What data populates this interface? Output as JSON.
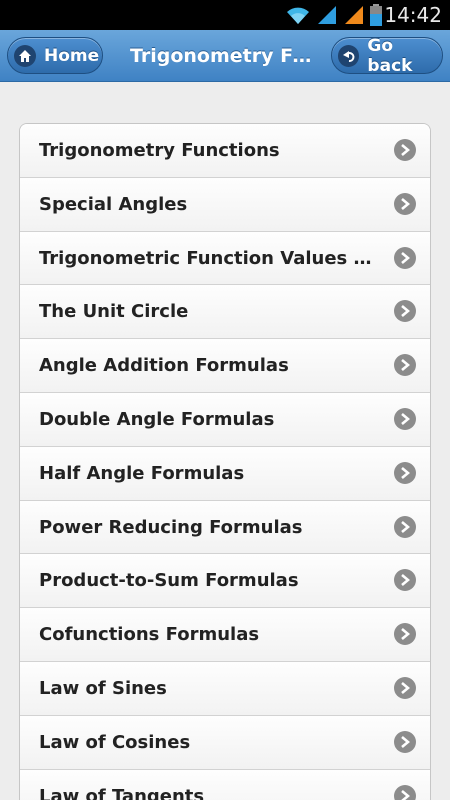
{
  "status_bar": {
    "time": "14:42",
    "icons": [
      "wifi-icon",
      "signal-icon",
      "signal-icon",
      "battery-icon"
    ]
  },
  "header": {
    "title": "Trigonometry For...",
    "home_label": "Home",
    "back_label": "Go back",
    "home_icon": "home-icon",
    "back_icon": "back-arrow-icon"
  },
  "list": {
    "items": [
      {
        "label": "Trigonometry Functions"
      },
      {
        "label": "Special Angles"
      },
      {
        "label": "Trigonometric Function Values in Q..."
      },
      {
        "label": "The Unit Circle"
      },
      {
        "label": "Angle Addition Formulas"
      },
      {
        "label": "Double Angle Formulas"
      },
      {
        "label": "Half Angle Formulas"
      },
      {
        "label": "Power Reducing Formulas"
      },
      {
        "label": "Product-to-Sum Formulas"
      },
      {
        "label": "Cofunctions Formulas"
      },
      {
        "label": "Law of Sines"
      },
      {
        "label": "Law of Cosines"
      },
      {
        "label": "Law of Tangents"
      }
    ]
  },
  "colors": {
    "header_top": "#6aa6db",
    "header_bottom": "#3f82c4",
    "button_blue": "#2e6cab",
    "arrow_gray": "#8c8c8c"
  }
}
